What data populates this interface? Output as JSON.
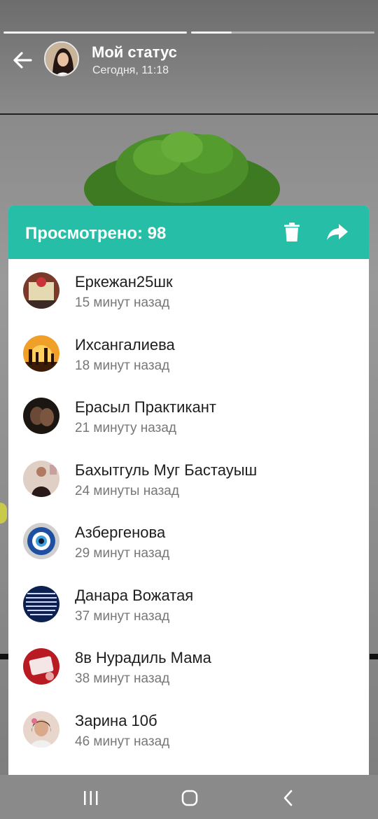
{
  "status": {
    "title": "Мой статус",
    "time": "Сегодня, 11:18",
    "progress": [
      1.0,
      0.22
    ]
  },
  "panel": {
    "viewed_label": "Просмотрено: 98",
    "accent_color": "#26bea7",
    "icons": [
      "delete-icon",
      "share-forward-icon"
    ]
  },
  "viewers": [
    {
      "name": "Еркежан25шк",
      "time": "15 минут назад"
    },
    {
      "name": "Ихсангалиева",
      "time": "18 минут назад"
    },
    {
      "name": "Ерасыл Практикант",
      "time": "21 минуту назад"
    },
    {
      "name": "Бахытгуль Муг Бастауыш",
      "time": "24 минуты назад"
    },
    {
      "name": "Азбергенова",
      "time": "29 минут назад"
    },
    {
      "name": "Данара Вожатая",
      "time": "37 минут назад"
    },
    {
      "name": "8в Нурадиль Мама",
      "time": "38 минут назад"
    },
    {
      "name": "Зарина 10б",
      "time": "46 минут назад"
    }
  ],
  "navbar": {
    "icons": [
      "recent-apps-icon",
      "home-icon",
      "back-icon"
    ]
  }
}
